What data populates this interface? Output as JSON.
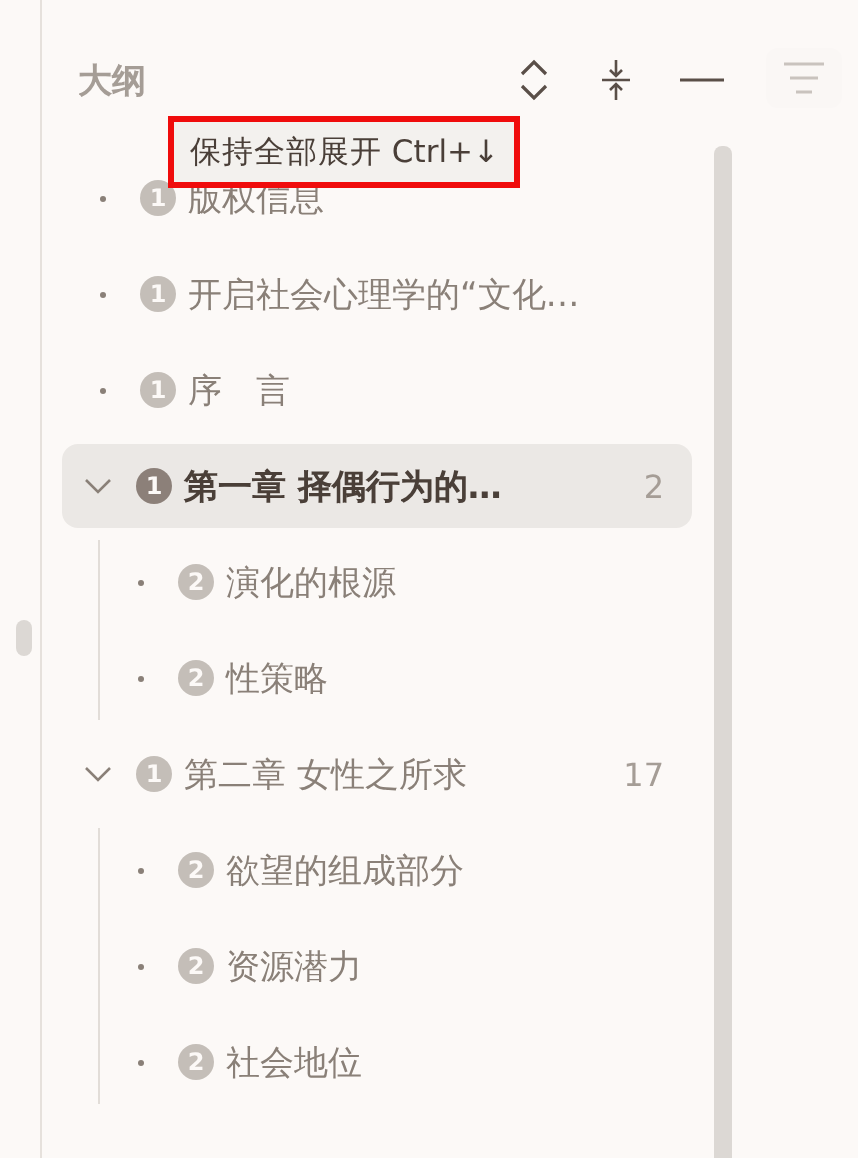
{
  "panel": {
    "title": "大纲"
  },
  "tooltip": {
    "text": "保持全部展开 Ctrl+↓"
  },
  "outline": [
    {
      "label": "版权信息",
      "badge": "1",
      "selected": false
    },
    {
      "label": "开启社会心理学的“文化…",
      "badge": "1",
      "selected": false
    },
    {
      "label": "序　言",
      "badge": "1",
      "selected": false
    },
    {
      "label": "第一章 择偶行为的…",
      "badge": "1",
      "count": "2",
      "selected": true,
      "expanded": true,
      "children": [
        {
          "label": "演化的根源",
          "badge": "2",
          "selected": false
        },
        {
          "label": "性策略",
          "badge": "2",
          "selected": false
        }
      ]
    },
    {
      "label": "第二章 女性之所求",
      "badge": "1",
      "count": "17",
      "selected": false,
      "expanded": true,
      "children": [
        {
          "label": "欲望的组成部分",
          "badge": "2",
          "selected": false
        },
        {
          "label": "资源潜力",
          "badge": "2",
          "selected": false
        },
        {
          "label": "社会地位",
          "badge": "2",
          "selected": false
        }
      ]
    }
  ]
}
